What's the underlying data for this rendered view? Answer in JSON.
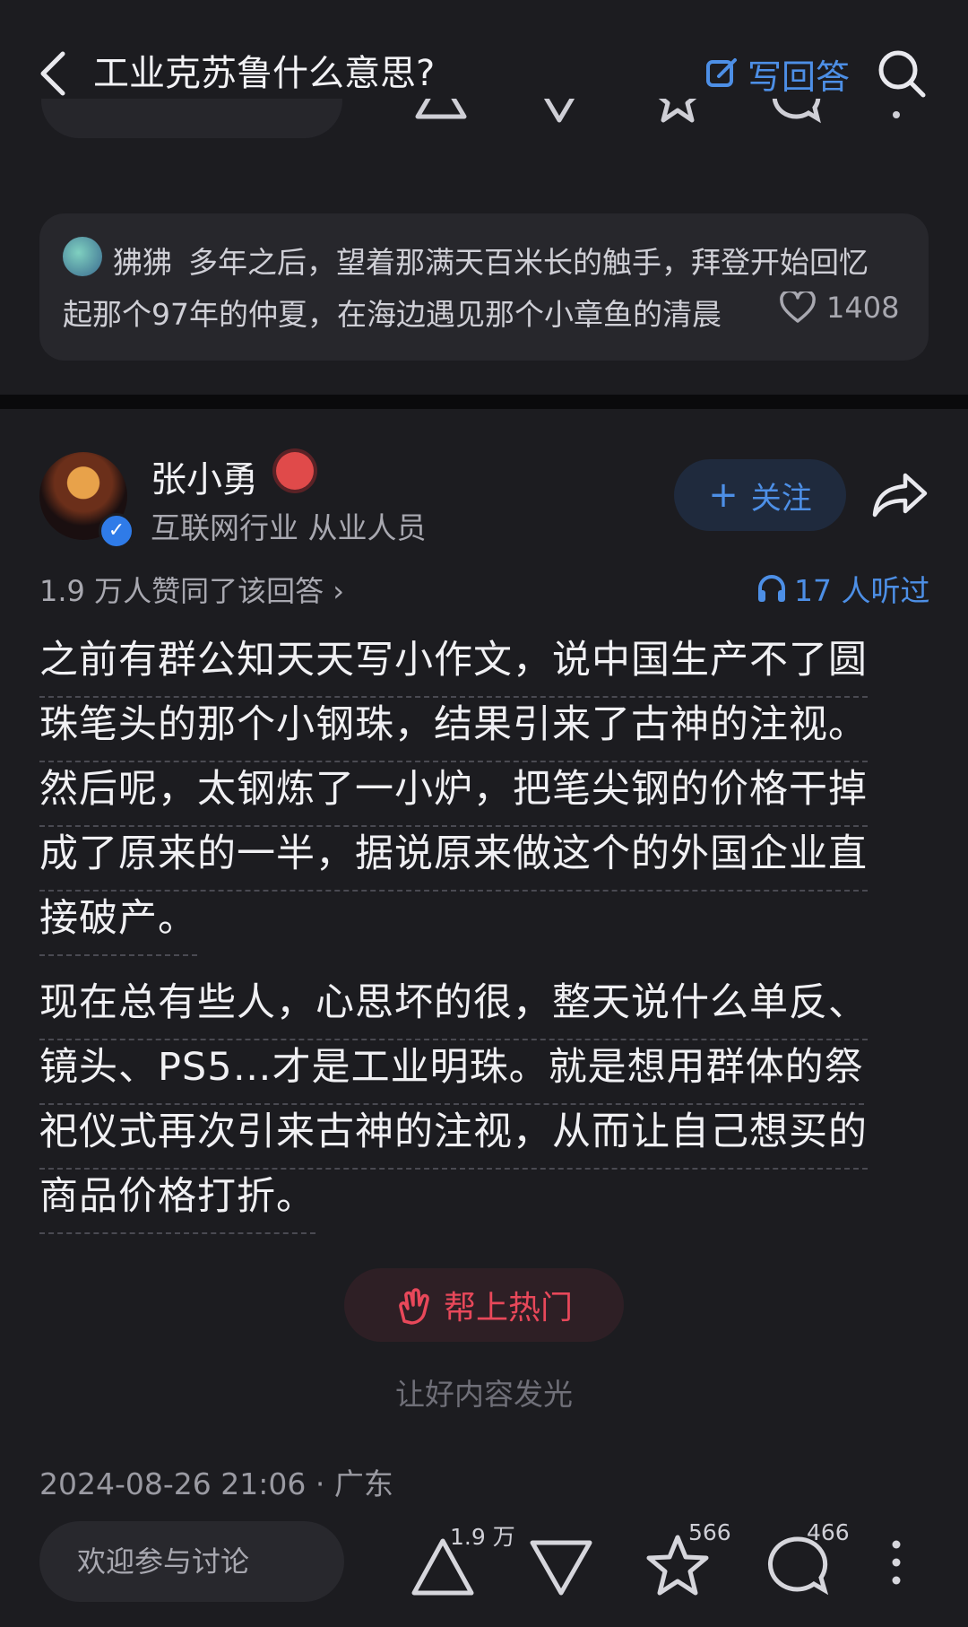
{
  "header": {
    "title": "工业克苏鲁什么意思?",
    "write_answer": "写回答"
  },
  "comment": {
    "author": "狒狒",
    "line1": "多年之后，望着那满天百米长的触手，拜登开始回忆",
    "line2": "起那个97年的仲夏，在海边遇见那个小章鱼的清晨",
    "likes": "1408"
  },
  "answer": {
    "author": "张小勇",
    "author_title": "互联网行业 从业人员",
    "follow_label": "关注",
    "agree_text": "1.9 万人赞同了该回答 ›",
    "listen_text": "17 人听过",
    "paragraphs": [
      [
        "之前有群公知天天写小作文，说中国生产不了圆",
        "珠笔头的那个小钢珠，结果引来了古神的注视。",
        "然后呢，太钢炼了一小炉，把笔尖钢的价格干掉",
        "成了原来的一半，据说原来做这个的外国企业直",
        "接破产。"
      ],
      [
        "现在总有些人，心思坏的很，整天说什么单反、",
        "镜头、PS5…才是工业明珠。就是想用群体的祭",
        "祀仪式再次引来古神的注视，从而让自己想买的",
        "商品价格打折。"
      ]
    ],
    "boost_label": "帮上热门",
    "boost_sub": "让好内容发光",
    "timestamp": "2024-08-26 21:06 · 广东"
  },
  "bottom_bar": {
    "discuss_placeholder": "欢迎参与讨论",
    "upvote_count": "1.9 万",
    "favorite_count": "566",
    "comment_count": "466"
  },
  "colors": {
    "background": "#1c1c20",
    "accent": "#4d8fe6",
    "boost": "#e8485a"
  }
}
